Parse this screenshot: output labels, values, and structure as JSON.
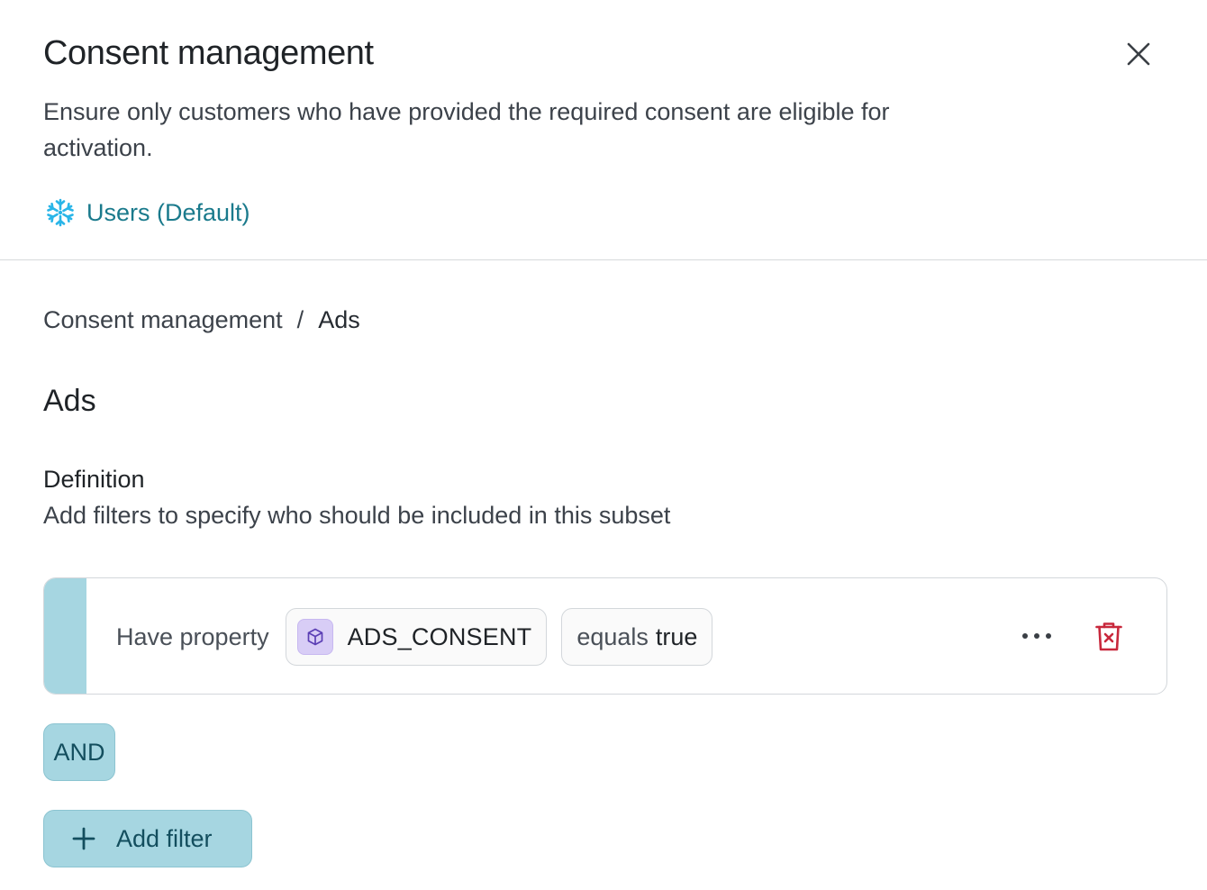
{
  "header": {
    "title": "Consent management",
    "subtitle": "Ensure only customers who have provided the required consent are eligible for activation.",
    "source_label": "Users (Default)",
    "source_icon": "snowflake-icon",
    "close_icon": "close-icon"
  },
  "breadcrumb": {
    "root": "Consent management",
    "separator": "/",
    "current": "Ads"
  },
  "section": {
    "title": "Ads",
    "definition_title": "Definition",
    "definition_description": "Add filters to specify who should be included in this subset"
  },
  "filters": [
    {
      "prefix": "Have property",
      "property_icon": "cube-icon",
      "property": "ADS_CONSENT",
      "operator": "equals",
      "value": "true",
      "more_icon": "more-icon",
      "delete_icon": "trash-icon"
    }
  ],
  "actions": {
    "and_label": "AND",
    "add_filter_label": "Add filter",
    "add_icon": "plus-icon"
  },
  "colors": {
    "accent": "#a6d6e1",
    "link": "#1a7a8c",
    "danger": "#c8283c",
    "property_chip": "#d8cdf6",
    "snowflake": "#29b5e8"
  }
}
